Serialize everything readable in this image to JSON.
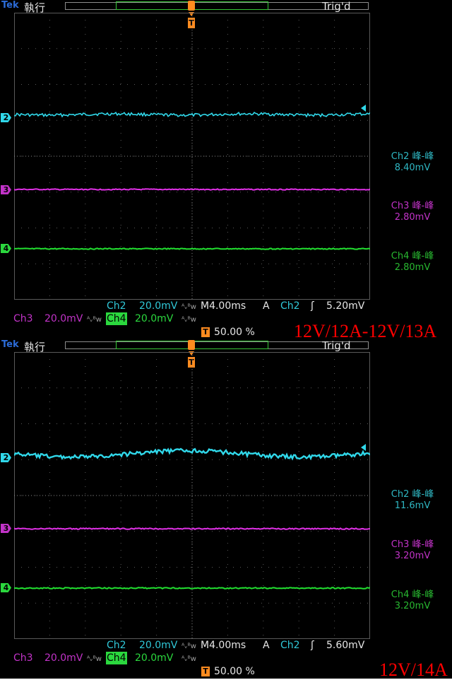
{
  "panels": [
    {
      "brand": "Tek",
      "run_state": "執行",
      "trigger_status": "Trig'd",
      "trigger_marker": "T",
      "channel_markers": {
        "ch2": "2",
        "ch3": "3",
        "ch4": "4"
      },
      "measurements": [
        {
          "label": "Ch2 峰-峰",
          "value": "8.40mV"
        },
        {
          "label": "Ch3 峰-峰",
          "value": "2.80mV"
        },
        {
          "label": "Ch4 峰-峰",
          "value": "2.80mV"
        }
      ],
      "status": {
        "ch2_label": "Ch2",
        "ch2_scale": "20.0mV",
        "bw_symbol": "ᴬᵥᴮw",
        "timebase": "M4.00ms",
        "trigger_mode": "A",
        "trigger_source": "Ch2",
        "trigger_slope": "ʃ",
        "trigger_level": "5.20mV",
        "ch3_label": "Ch3",
        "ch3_scale": "20.0mV",
        "ch4_label": "Ch4",
        "ch4_scale": "20.0mV",
        "trigger_position": "50.00 %",
        "trigger_position_icon": "T"
      },
      "annotation": "12V/12A-12V/13A",
      "traces": {
        "ch2_noise_amplitude_mv": 8.4,
        "ch3_noise_amplitude_mv": 2.8,
        "ch4_noise_amplitude_mv": 2.8
      }
    },
    {
      "brand": "Tek",
      "run_state": "執行",
      "trigger_status": "Trig'd",
      "trigger_marker": "T",
      "channel_markers": {
        "ch2": "2",
        "ch3": "3",
        "ch4": "4"
      },
      "measurements": [
        {
          "label": "Ch2 峰-峰",
          "value": "11.6mV"
        },
        {
          "label": "Ch3 峰-峰",
          "value": "3.20mV"
        },
        {
          "label": "Ch4 峰-峰",
          "value": "3.20mV"
        }
      ],
      "status": {
        "ch2_label": "Ch2",
        "ch2_scale": "20.0mV",
        "bw_symbol": "ᴬᵥᴮw",
        "timebase": "M4.00ms",
        "trigger_mode": "A",
        "trigger_source": "Ch2",
        "trigger_slope": "ʃ",
        "trigger_level": "5.60mV",
        "ch3_label": "Ch3",
        "ch3_scale": "20.0mV",
        "ch4_label": "Ch4",
        "ch4_scale": "20.0mV",
        "trigger_position": "50.00 %",
        "trigger_position_icon": "T"
      },
      "annotation": "12V/14A",
      "traces": {
        "ch2_noise_amplitude_mv": 11.6,
        "ch3_noise_amplitude_mv": 3.2,
        "ch4_noise_amplitude_mv": 3.2
      }
    }
  ],
  "colors": {
    "ch2": "#30d8ea",
    "ch3": "#e030e6",
    "ch4": "#22e030",
    "trigger": "#ff8b1f",
    "annotation": "#ff0000",
    "grid": "#5a5a5a"
  }
}
